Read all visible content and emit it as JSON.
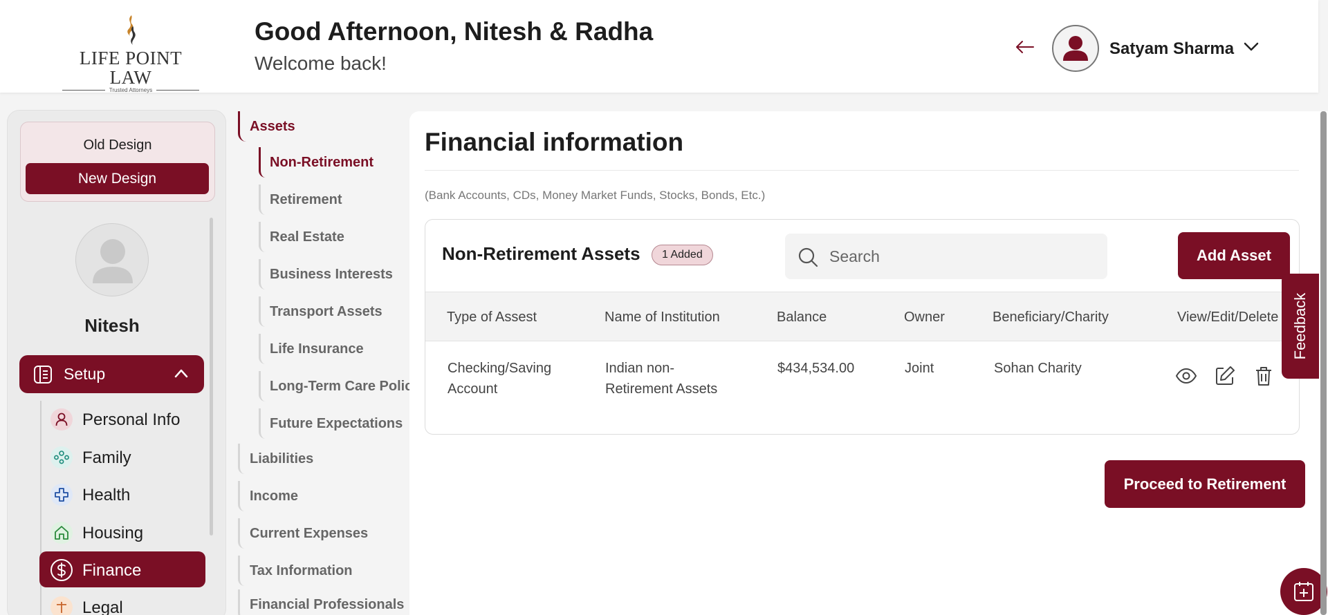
{
  "brand": {
    "logo_text": "LIFE POINT LAW",
    "logo_tagline": "Trusted Attorneys",
    "accent_color": "#7a0f25"
  },
  "header": {
    "greeting": "Good Afternoon, Nitesh & Radha",
    "subtitle": "Welcome back!",
    "user_name": "Satyam Sharma"
  },
  "design_toggle": {
    "old_label": "Old Design",
    "new_label": "New Design"
  },
  "profile": {
    "name": "Nitesh"
  },
  "sidebar": {
    "setup_label": "Setup",
    "items": [
      {
        "label": "Personal Info",
        "icon": "user-icon"
      },
      {
        "label": "Family",
        "icon": "family-icon"
      },
      {
        "label": "Health",
        "icon": "health-cross-icon"
      },
      {
        "label": "Housing",
        "icon": "house-icon"
      },
      {
        "label": "Finance",
        "icon": "dollar-icon",
        "active": true
      },
      {
        "label": "Legal",
        "icon": "legal-icon"
      }
    ]
  },
  "subnav": {
    "assets": "Assets",
    "children": [
      "Non-Retirement",
      "Retirement",
      "Real Estate",
      "Business Interests",
      "Transport Assets",
      "Life Insurance",
      "Long-Term Care Policy",
      "Future Expectations"
    ],
    "sections": [
      "Liabilities",
      "Income",
      "Current Expenses",
      "Tax Information",
      "Financial Professionals"
    ]
  },
  "main": {
    "title": "Financial information",
    "subtitle": "(Bank Accounts, CDs, Money Market Funds, Stocks, Bonds, Etc.)",
    "card": {
      "title": "Non-Retirement Assets",
      "badge": "1 Added",
      "search_placeholder": "Search",
      "add_button": "Add Asset",
      "columns": [
        "Type of Assest",
        "Name of Institution",
        "Balance",
        "Owner",
        "Beneficiary/Charity",
        "View/Edit/Delete"
      ],
      "rows": [
        {
          "type_line1": "Checking/Saving",
          "type_line2": "Account",
          "institution_line1": "Indian non-",
          "institution_line2": "Retirement Assets",
          "balance": "$434,534.00",
          "owner": "Joint",
          "beneficiary": "Sohan Charity"
        }
      ]
    },
    "proceed_button": "Proceed to Retirement"
  },
  "feedback_label": "Feedback"
}
